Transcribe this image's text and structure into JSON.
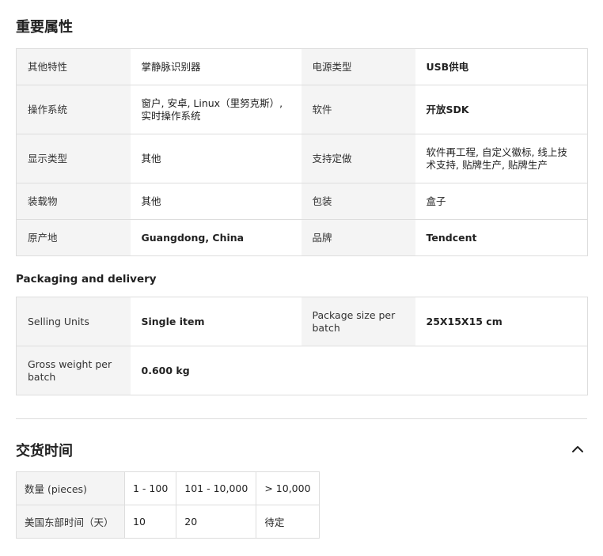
{
  "key_attributes": {
    "title": "重要属性",
    "rows": [
      [
        {
          "label": "其他特性",
          "value": "掌静脉识别器"
        },
        {
          "label": "电源类型",
          "value": "USB供电"
        }
      ],
      [
        {
          "label": "操作系统",
          "value": "窗户, 安卓, Linux（里努克斯）, 实时操作系统"
        },
        {
          "label": "软件",
          "value": "开放SDK"
        }
      ],
      [
        {
          "label": "显示类型",
          "value": "其他"
        },
        {
          "label": "支持定做",
          "value": "软件再工程, 自定义徽标, 线上技术支持, 贴牌生产, 贴牌生产"
        }
      ],
      [
        {
          "label": "装载物",
          "value": "其他"
        },
        {
          "label": "包装",
          "value": "盒子"
        }
      ],
      [
        {
          "label": "原产地",
          "value": "Guangdong, China"
        },
        {
          "label": "品牌",
          "value": "Tendcent"
        }
      ]
    ]
  },
  "packaging": {
    "title": "Packaging and delivery",
    "rows": [
      [
        {
          "label": "Selling Units",
          "value": "Single item"
        },
        {
          "label": "Package size per batch",
          "value": "25X15X15 cm"
        }
      ],
      [
        {
          "label": "Gross weight per batch",
          "value": "0.600 kg"
        }
      ]
    ]
  },
  "lead_time": {
    "title": "交货时间",
    "collapse_icon": "chevron-up-icon",
    "quantity_label": "数量 (pieces)",
    "time_label": "美国东部时间（天）",
    "ranges": [
      "1 - 100",
      "101 - 10,000",
      "> 10,000"
    ],
    "days": [
      "10",
      "20",
      "待定"
    ]
  }
}
